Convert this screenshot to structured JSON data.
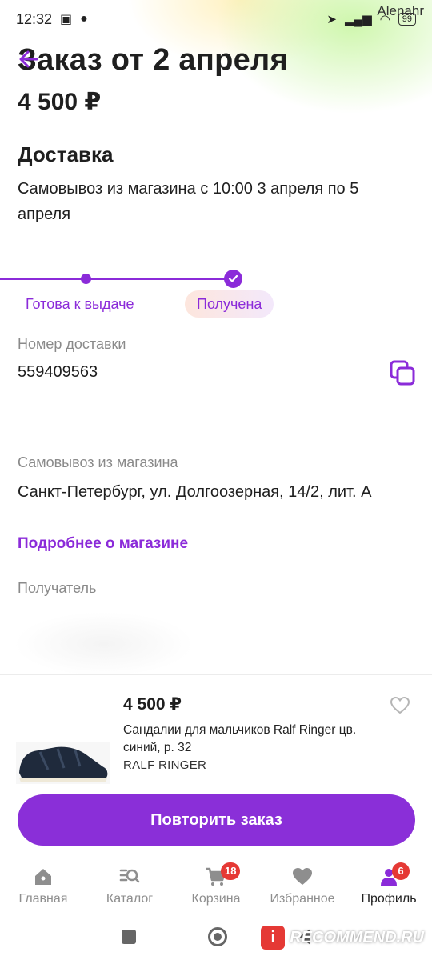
{
  "status_bar": {
    "time": "12:32",
    "battery": "99",
    "watermark_user": "Alenahr"
  },
  "header": {
    "title": "Заказ от 2 апреля",
    "price": "4 500 ₽"
  },
  "delivery": {
    "heading": "Доставка",
    "description": "Самовывоз из магазина с 10:00 3 апреля по 5 апреля"
  },
  "progress": {
    "steps": [
      "Готова к выдаче",
      "Получена"
    ],
    "current_step": "Получена",
    "accent_color": "#8b2bd9"
  },
  "delivery_number": {
    "label": "Номер доставки",
    "value": "559409563"
  },
  "pickup": {
    "label": "Самовывоз из магазина",
    "address": "Санкт-Петербург, ул. Долгоозерная, 14/2, лит. А",
    "link": "Подробнее о магазине"
  },
  "recipient": {
    "label": "Получатель"
  },
  "product": {
    "price": "4 500 ₽",
    "name": "Сандалии для мальчиков Ralf Ringer цв. синий, р. 32",
    "brand": "RALF RINGER"
  },
  "repeat_button": "Повторить заказ",
  "bottom_nav": [
    {
      "label": "Главная",
      "icon": "home-icon"
    },
    {
      "label": "Каталог",
      "icon": "catalog-search-icon"
    },
    {
      "label": "Корзина",
      "icon": "cart-icon",
      "badge": "18"
    },
    {
      "label": "Избранное",
      "icon": "heart-icon"
    },
    {
      "label": "Профиль",
      "icon": "profile-icon",
      "badge": "6",
      "active": true
    }
  ],
  "watermark": {
    "badge": "i",
    "text": "RECOMMEND.RU"
  }
}
